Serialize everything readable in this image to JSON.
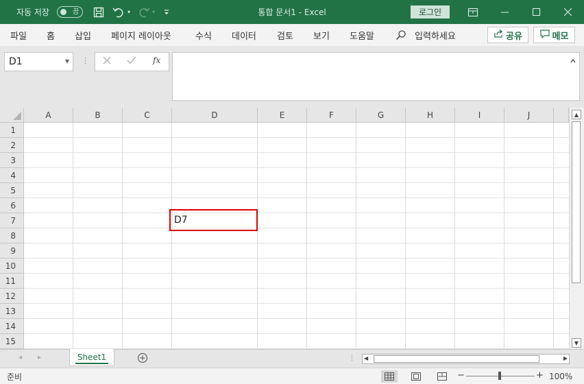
{
  "titlebar": {
    "autosave_label": "자동 저장",
    "autosave_state": "끔",
    "title": "통합 문서1  -  Excel",
    "login_label": "로그인"
  },
  "menu": {
    "items": [
      "파일",
      "홈",
      "삽입",
      "페이지 레이아웃",
      "수식",
      "데이터",
      "검토",
      "보기",
      "도움말"
    ],
    "search_label": "입력하세요",
    "share_label": "공유",
    "memo_label": "메모"
  },
  "formula_bar": {
    "name_box": "D1",
    "fx_label": "fx",
    "formula_value": ""
  },
  "grid": {
    "columns": [
      "A",
      "B",
      "C",
      "D",
      "E",
      "F",
      "G",
      "H",
      "I",
      "J"
    ],
    "rows": [
      "1",
      "2",
      "3",
      "4",
      "5",
      "6",
      "7",
      "8",
      "9",
      "10",
      "11",
      "12",
      "13",
      "14",
      "15"
    ],
    "cells": {
      "D7": "D7"
    },
    "highlight_color": "#e00000"
  },
  "sheets": {
    "tabs": [
      "Sheet1"
    ],
    "active": "Sheet1"
  },
  "status": {
    "ready_label": "준비",
    "zoom_level": "100%"
  },
  "colors": {
    "accent": "#217346"
  },
  "icons": [
    "save-icon",
    "undo-icon",
    "redo-icon",
    "customize-toolbar-icon",
    "ribbon-display-icon",
    "minimize-icon",
    "maximize-icon",
    "close-icon",
    "search-icon",
    "share-icon",
    "comment-icon",
    "name-box-dropdown-icon",
    "cancel-icon",
    "enter-icon",
    "function-icon",
    "collapse-formula-bar-icon",
    "scroll-up-icon",
    "scroll-down-icon",
    "scroll-left-icon",
    "scroll-right-icon",
    "add-sheet-icon",
    "normal-view-icon",
    "page-layout-view-icon",
    "page-break-view-icon"
  ]
}
